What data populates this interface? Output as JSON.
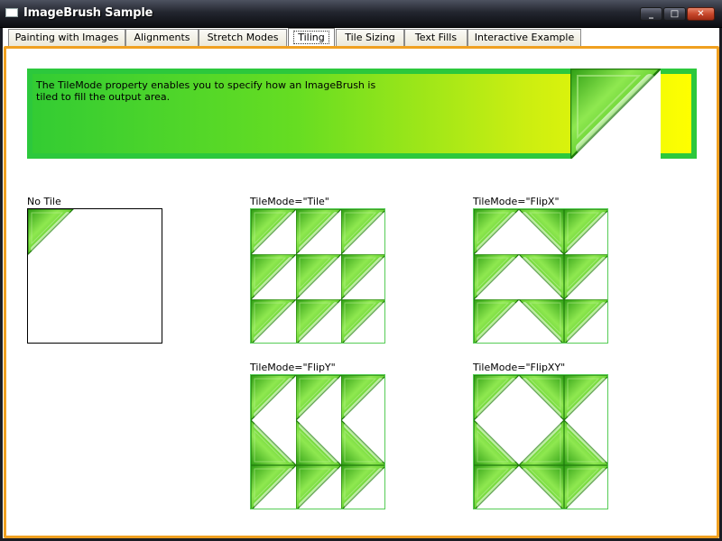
{
  "window": {
    "title": "ImageBrush Sample",
    "min_glyph": "_",
    "max_glyph": "□",
    "close_glyph": "✕"
  },
  "tabs": [
    {
      "label": "Painting with Images",
      "selected": false
    },
    {
      "label": "Alignments",
      "selected": false
    },
    {
      "label": "Stretch Modes",
      "selected": false
    },
    {
      "label": "Tiling",
      "selected": true
    },
    {
      "label": "Tile Sizing",
      "selected": false
    },
    {
      "label": "Text Fills",
      "selected": false
    },
    {
      "label": "Interactive Example",
      "selected": false
    }
  ],
  "banner": {
    "text": "The TileMode property enables you to specify how an ImageBrush is tiled to fill the output area."
  },
  "samples": {
    "none": {
      "label": "No Tile"
    },
    "tile": {
      "label": "TileMode=\"Tile\""
    },
    "flipx": {
      "label": "TileMode=\"FlipX\""
    },
    "flipy": {
      "label": "TileMode=\"FlipY\""
    },
    "flipxy": {
      "label": "TileMode=\"FlipXY\""
    }
  },
  "colors": {
    "accent_border": "#f0a020",
    "banner_border": "#2cc83c",
    "gradient_start": "#33cc33",
    "gradient_end": "#ffff00",
    "triangle_green": "#44bb22"
  }
}
